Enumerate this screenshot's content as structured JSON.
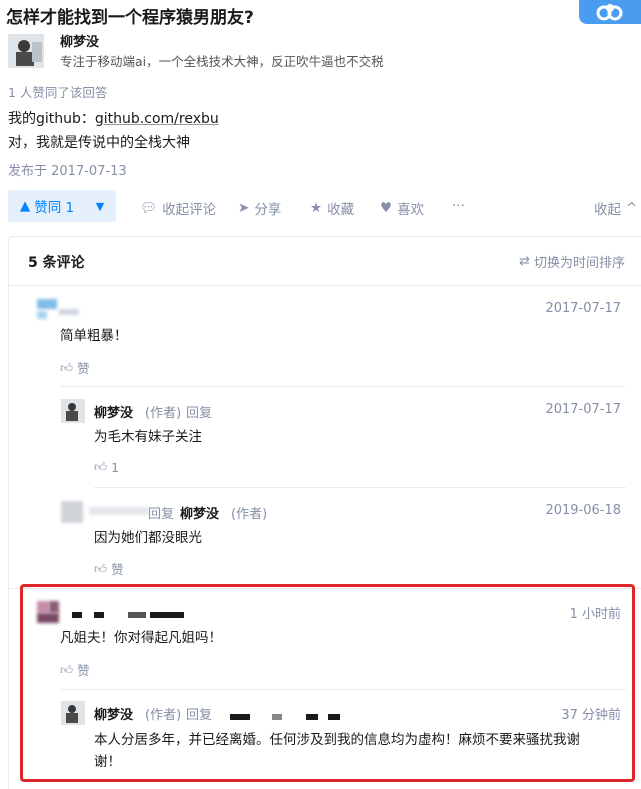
{
  "question": {
    "title": "怎样才能找到一个程序猿男朋友?"
  },
  "author": {
    "name": "柳梦没",
    "bio": "专注于移动端ai，一个全栈技术大神，反正吹牛逼也不交税"
  },
  "answer": {
    "likes_info": "1 人赞同了该回答",
    "line1_prefix": "我的github：",
    "line1_link": "github.com/rexbu",
    "line2": "对，我就是传说中的全栈大神",
    "published": "发布于 2017-07-13"
  },
  "actions": {
    "vote_label": "赞同 1",
    "collapse_comments": "收起评论",
    "share": "分享",
    "favorite": "收藏",
    "like": "喜欢",
    "more": "···",
    "collapse": "收起"
  },
  "comments": {
    "title": "5 条评论",
    "sort_label": "切换为时间排序",
    "items": [
      {
        "date": "2017-07-17",
        "text": "简单粗暴！",
        "like": "赞"
      },
      {
        "name": "柳梦没",
        "role": "(作者)",
        "reply": "回复",
        "date": "2017-07-17",
        "text": "为毛木有妹子关注",
        "like": "1"
      },
      {
        "reply": "回复",
        "target": "柳梦没",
        "role": "(作者)",
        "date": "2019-06-18",
        "text": "因为她们都没眼光",
        "like": "赞"
      },
      {
        "date": "1 小时前",
        "text": "凡姐夫！你对得起凡姐吗！",
        "like": "赞"
      },
      {
        "name": "柳梦没",
        "role": "(作者)",
        "reply": "回复",
        "date": "37 分钟前",
        "text_line1": "本人分居多年，并已经离婚。任何涉及到我的信息均为虚构！麻烦不要来骚扰我谢",
        "text_line2": "谢！"
      }
    ]
  }
}
